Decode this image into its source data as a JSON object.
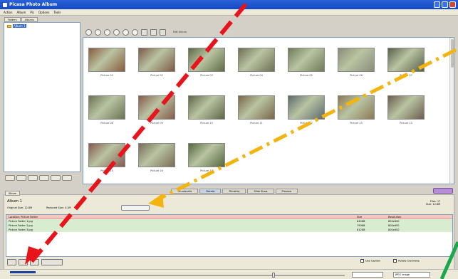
{
  "window": {
    "title": "Picasa Photo Album",
    "colors": {
      "titlebar": "#1f57d0",
      "close": "#d8442c"
    }
  },
  "menu": {
    "items": [
      "Action",
      "Album",
      "Pic",
      "Options",
      "Tools"
    ]
  },
  "left": {
    "tabs": [
      "Folders",
      "Albums"
    ],
    "tree": [
      {
        "label": "Album 1",
        "selected": true
      }
    ]
  },
  "toolbar": {
    "label": "Edit Album"
  },
  "gallery": {
    "thumbs": [
      {
        "caption": "Picture 01",
        "color": "#8a5b3e"
      },
      {
        "caption": "Picture 02",
        "color": "#7d5a47"
      },
      {
        "caption": "Picture 03",
        "color": "#5f6b45"
      },
      {
        "caption": "Picture 04",
        "color": "#6f6f55"
      },
      {
        "caption": "Picture 05",
        "color": "#6e7a58"
      },
      {
        "caption": "Picture 06",
        "color": "#8a8d79"
      },
      {
        "caption": "Picture 07",
        "color": "#59614a"
      },
      {
        "caption": "Picture 08",
        "color": "#6b7354"
      },
      {
        "caption": "Picture 09",
        "color": "#865a4d"
      },
      {
        "caption": "Picture 10",
        "color": "#5f6648"
      },
      {
        "caption": "Picture 11",
        "color": "#7a6648"
      },
      {
        "caption": "Picture 12",
        "color": "#5e6a6e"
      },
      {
        "caption": "Picture 13",
        "color": "#8a7a55"
      },
      {
        "caption": "Picture 14",
        "color": "#6d5d4f"
      },
      {
        "caption": "Picture 15",
        "color": "#855a52"
      },
      {
        "caption": "Picture 16",
        "color": "#7a6c58"
      },
      {
        "caption": "Picture 17",
        "color": "#55683e"
      }
    ]
  },
  "viewtabs": [
    "Thumbnails",
    "Details",
    "Filmstrip",
    "Slide Show",
    "Preview"
  ],
  "bottom": {
    "tab": "Album",
    "album_title": "Album 1",
    "album_fields": [
      "Original Size: 12.8M",
      "Reduced Size: 4.1M"
    ],
    "right_info": [
      "Files: 17",
      "Size: 12.8M"
    ],
    "table": {
      "headers": [
        "Location: Picture Folder",
        "Size",
        "Resolution"
      ],
      "rows": [
        [
          "Picture Folder 1.jpg",
          "840KB",
          "800x600"
        ],
        [
          "Picture Folder 2.jpg",
          "790KB",
          "800x600"
        ],
        [
          "Picture Folder 3.jpg",
          "812KB",
          "800x600"
        ]
      ]
    },
    "checks": [
      "Use Caption",
      "Rotate Clockwise"
    ],
    "combo2": "JPEG image"
  },
  "annotations": {
    "colors": {
      "red": "#e8141c",
      "yellow": "#f4b410",
      "green": "#19a84a"
    }
  }
}
